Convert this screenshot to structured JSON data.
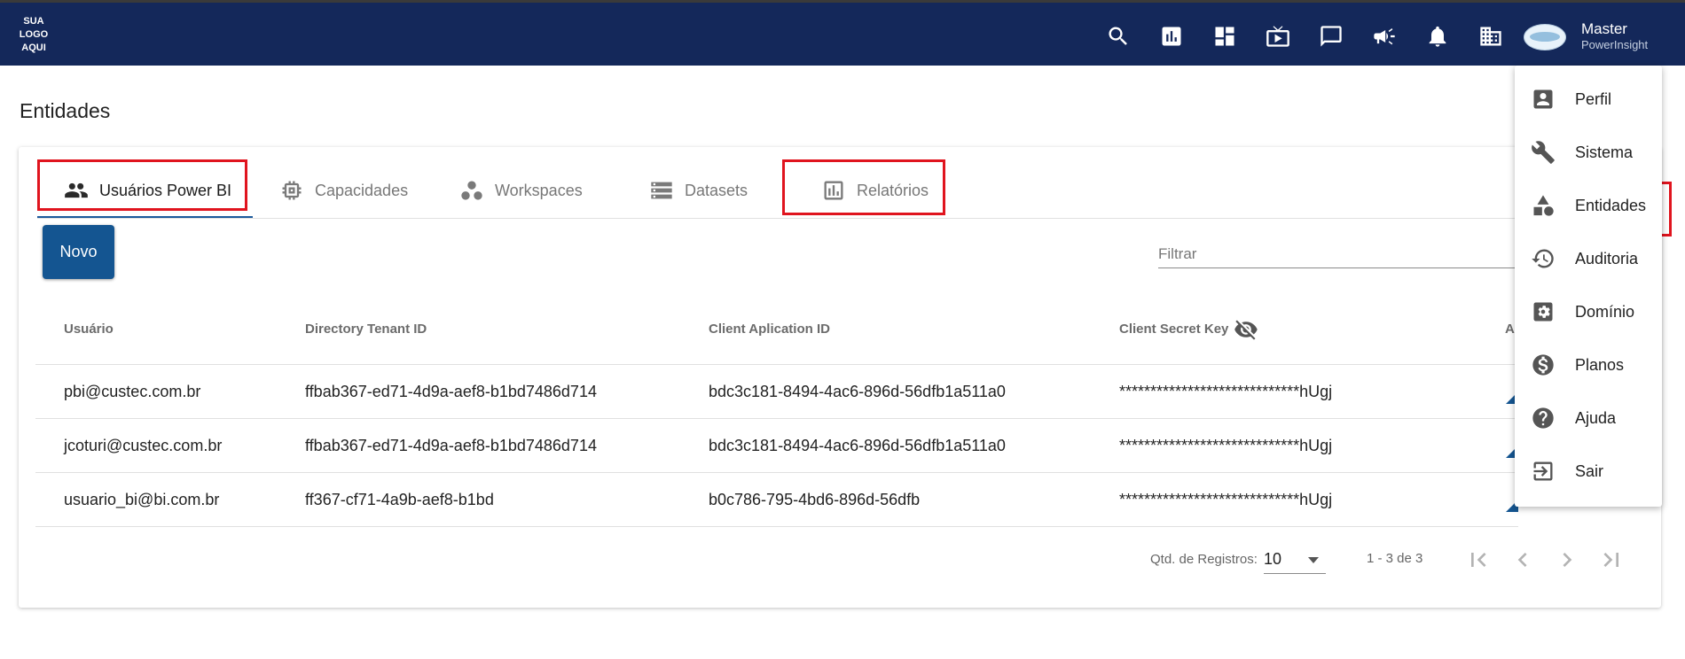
{
  "header": {
    "logo_text": [
      "SUA",
      "LOGO",
      "AQUI"
    ],
    "icons": [
      "search-icon",
      "report-icon",
      "dashboard-icon",
      "tv-icon",
      "chat-icon",
      "campaign-icon",
      "notifications-icon",
      "building-icon"
    ],
    "user_name": "Master",
    "user_subtitle": "PowerInsight",
    "bar_color": "#14285a"
  },
  "page": {
    "title": "Entidades"
  },
  "tabs": [
    {
      "label": "Usuários Power BI",
      "icon": "group-icon",
      "active": true
    },
    {
      "label": "Capacidades",
      "icon": "chip-icon",
      "active": false
    },
    {
      "label": "Workspaces",
      "icon": "workspaces-icon",
      "active": false
    },
    {
      "label": "Datasets",
      "icon": "storage-icon",
      "active": false
    },
    {
      "label": "Relatórios",
      "icon": "bar-chart-icon",
      "active": false
    }
  ],
  "toolbar": {
    "new_label": "Novo",
    "filter_placeholder": "Filtrar",
    "accent_color": "#145591"
  },
  "table": {
    "columns": [
      "Usuário",
      "Directory Tenant ID",
      "Client Aplication ID",
      "Client Secret Key",
      "A"
    ],
    "rows": [
      {
        "user": "pbi@custec.com.br",
        "tenant": "ffbab367-ed71-4d9a-aef8-b1bd7486d714",
        "client": "bdc3c181-8494-4ac6-896d-56dfb1a511a0",
        "secret": "*****************************hUgj"
      },
      {
        "user": "jcoturi@custec.com.br",
        "tenant": "ffbab367-ed71-4d9a-aef8-b1bd7486d714",
        "client": "bdc3c181-8494-4ac6-896d-56dfb1a511a0",
        "secret": "*****************************hUgj"
      },
      {
        "user": "usuario_bi@bi.com.br",
        "tenant": "ff367-cf71-4a9b-aef8-b1bd",
        "client": "b0c786-795-4bd6-896d-56dfb",
        "secret": "*****************************hUgj"
      }
    ]
  },
  "pagination": {
    "label": "Qtd. de Registros:",
    "page_size": "10",
    "range": "1 - 3 de 3"
  },
  "menu": {
    "items": [
      {
        "label": "Perfil",
        "icon": "profile-icon"
      },
      {
        "label": "Sistema",
        "icon": "wrench-icon"
      },
      {
        "label": "Entidades",
        "icon": "shapes-icon"
      },
      {
        "label": "Auditoria",
        "icon": "history-icon"
      },
      {
        "label": "Domínio",
        "icon": "settings-icon"
      },
      {
        "label": "Planos",
        "icon": "dollar-icon"
      },
      {
        "label": "Ajuda",
        "icon": "help-icon"
      },
      {
        "label": "Sair",
        "icon": "logout-icon"
      }
    ]
  },
  "highlight_color": "#e0141e"
}
